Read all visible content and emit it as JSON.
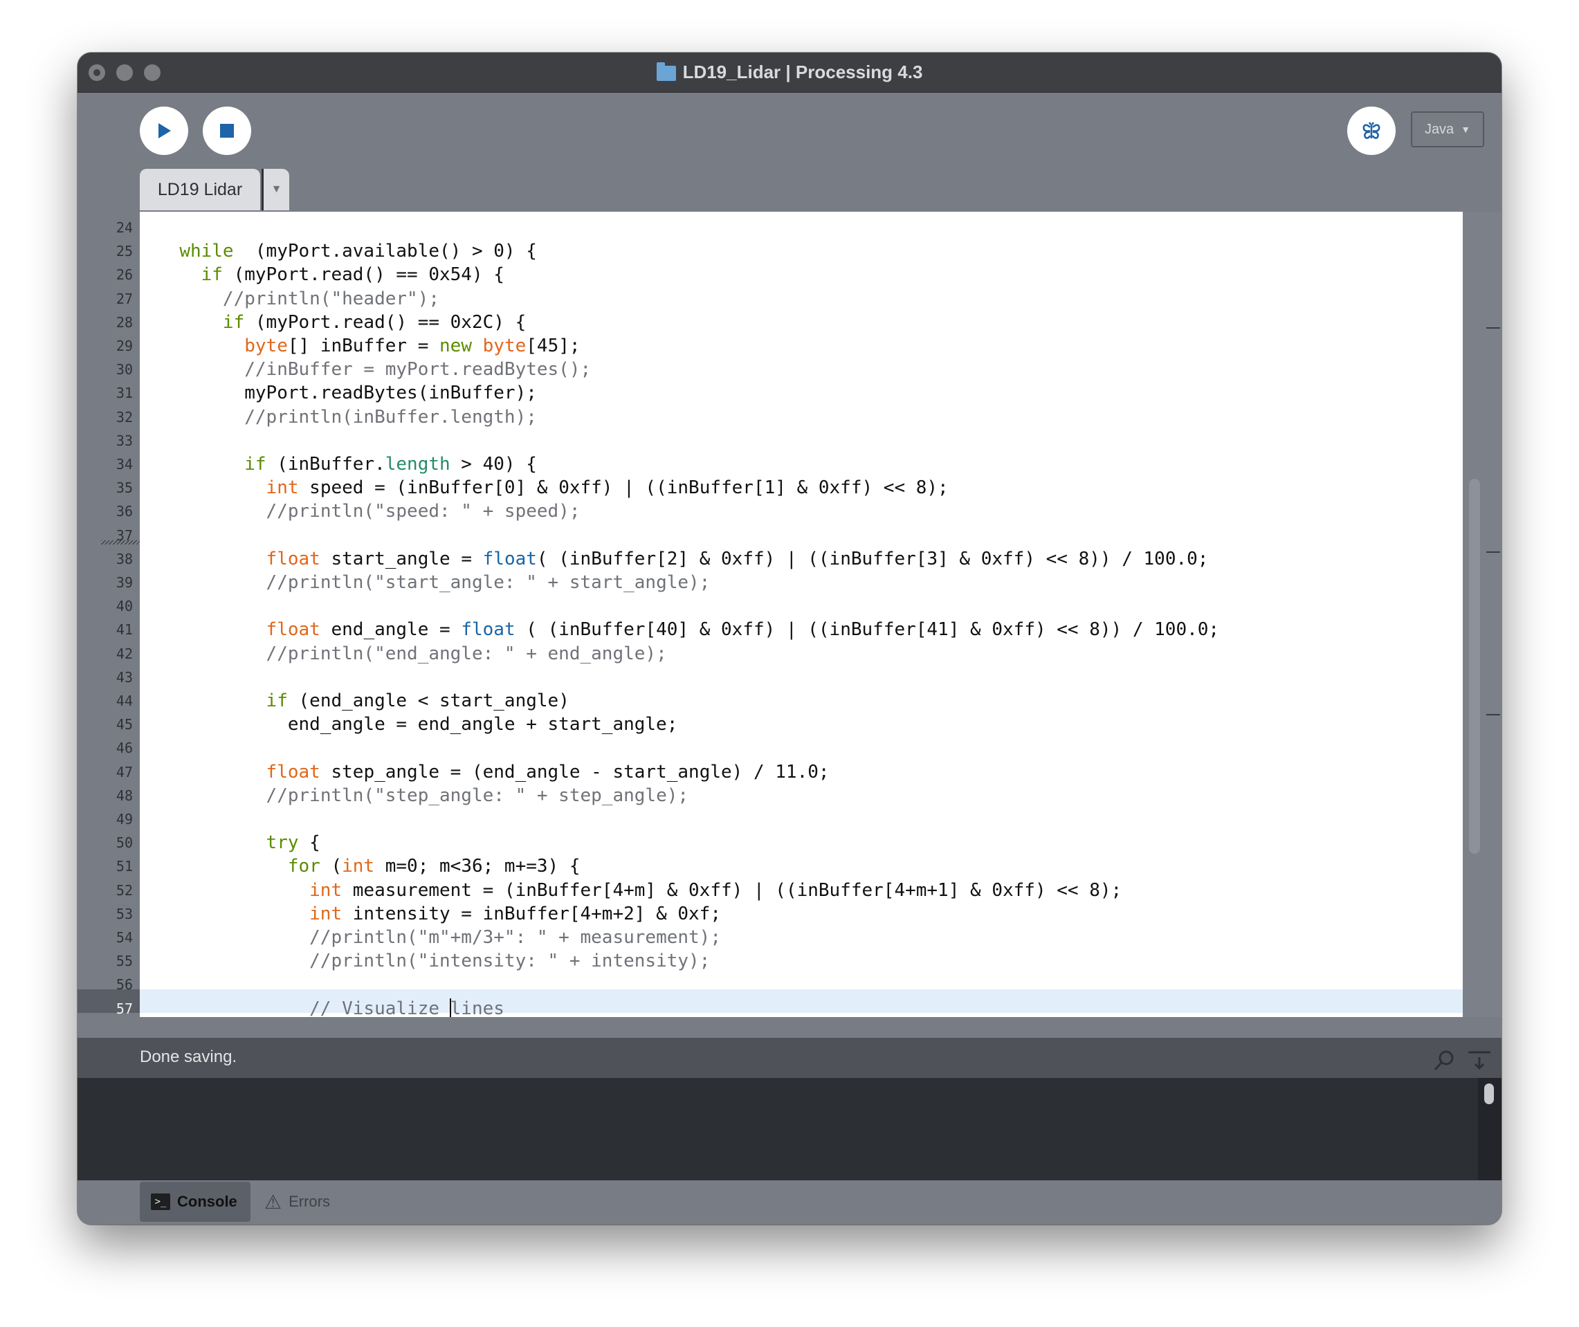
{
  "window": {
    "title": "LD19_Lidar | Processing 4.3"
  },
  "toolbar": {
    "run_icon": "play-icon",
    "stop_icon": "stop-icon",
    "debug_icon": "butterfly-icon",
    "mode_label": "Java",
    "mode_caret": "▼"
  },
  "tabs": [
    {
      "label": "LD19 Lidar"
    }
  ],
  "tab_menu_glyph": "▼",
  "editor": {
    "current_line": "57",
    "lines": [
      {
        "n": "24",
        "parts": []
      },
      {
        "n": "25",
        "parts": [
          [
            "k1",
            "while"
          ],
          [
            "",
            "  (myPort.available() > 0) {"
          ]
        ],
        "indent": "  "
      },
      {
        "n": "26",
        "parts": [
          [
            "k1",
            "if"
          ],
          [
            "",
            " (myPort.read() == 0x54) {"
          ]
        ],
        "indent": "    "
      },
      {
        "n": "27",
        "parts": [
          [
            "c",
            "//println(\"header\");"
          ]
        ],
        "indent": "      "
      },
      {
        "n": "28",
        "parts": [
          [
            "k1",
            "if"
          ],
          [
            "",
            " (myPort.read() == 0x2C) {"
          ]
        ],
        "indent": "      "
      },
      {
        "n": "29",
        "parts": [
          [
            "k2",
            "byte"
          ],
          [
            "",
            "[] inBuffer = "
          ],
          [
            "k1",
            "new"
          ],
          [
            "",
            " "
          ],
          [
            "k2",
            "byte"
          ],
          [
            "",
            "[45];"
          ]
        ],
        "indent": "        "
      },
      {
        "n": "30",
        "parts": [
          [
            "c",
            "//inBuffer = myPort.readBytes();"
          ]
        ],
        "indent": "        "
      },
      {
        "n": "31",
        "parts": [
          [
            "",
            "myPort.readBytes(inBuffer);"
          ]
        ],
        "indent": "        "
      },
      {
        "n": "32",
        "parts": [
          [
            "c",
            "//println(inBuffer.length);"
          ]
        ],
        "indent": "        "
      },
      {
        "n": "33",
        "parts": []
      },
      {
        "n": "34",
        "parts": [
          [
            "k1",
            "if"
          ],
          [
            "",
            " (inBuffer."
          ],
          [
            "f",
            "length"
          ],
          [
            "",
            " > 40) {"
          ]
        ],
        "indent": "        "
      },
      {
        "n": "35",
        "parts": [
          [
            "k2",
            "int"
          ],
          [
            "",
            " speed = (inBuffer[0] & 0xff) | ((inBuffer[1] & 0xff) << 8);"
          ]
        ],
        "indent": "          "
      },
      {
        "n": "36",
        "parts": [
          [
            "c",
            "//println(\"speed: \" + speed);"
          ]
        ],
        "indent": "          "
      },
      {
        "n": "37",
        "parts": []
      },
      {
        "n": "38",
        "parts": [
          [
            "k2",
            "float"
          ],
          [
            "",
            " start_angle = "
          ],
          [
            "k3",
            "float"
          ],
          [
            "",
            "( (inBuffer[2] & 0xff) | ((inBuffer[3] & 0xff) << 8)) / 100.0;"
          ]
        ],
        "indent": "          "
      },
      {
        "n": "39",
        "parts": [
          [
            "c",
            "//println(\"start_angle: \" + start_angle);"
          ]
        ],
        "indent": "          "
      },
      {
        "n": "40",
        "parts": []
      },
      {
        "n": "41",
        "parts": [
          [
            "k2",
            "float"
          ],
          [
            "",
            " end_angle = "
          ],
          [
            "k3",
            "float"
          ],
          [
            "",
            " ( (inBuffer[40] & 0xff) | ((inBuffer[41] & 0xff) << 8)) / 100.0;"
          ]
        ],
        "indent": "          "
      },
      {
        "n": "42",
        "parts": [
          [
            "c",
            "//println(\"end_angle: \" + end_angle);"
          ]
        ],
        "indent": "          "
      },
      {
        "n": "43",
        "parts": []
      },
      {
        "n": "44",
        "parts": [
          [
            "k1",
            "if"
          ],
          [
            "",
            " (end_angle < start_angle)"
          ]
        ],
        "indent": "          "
      },
      {
        "n": "45",
        "parts": [
          [
            "",
            "end_angle = end_angle + start_angle;"
          ]
        ],
        "indent": "            "
      },
      {
        "n": "46",
        "parts": []
      },
      {
        "n": "47",
        "parts": [
          [
            "k2",
            "float"
          ],
          [
            "",
            " step_angle = (end_angle - start_angle) / 11.0;"
          ]
        ],
        "indent": "          "
      },
      {
        "n": "48",
        "parts": [
          [
            "c",
            "//println(\"step_angle: \" + step_angle);"
          ]
        ],
        "indent": "          "
      },
      {
        "n": "49",
        "parts": []
      },
      {
        "n": "50",
        "parts": [
          [
            "k1",
            "try"
          ],
          [
            "",
            " {"
          ]
        ],
        "indent": "          "
      },
      {
        "n": "51",
        "parts": [
          [
            "k1",
            "for"
          ],
          [
            "",
            " ("
          ],
          [
            "k2",
            "int"
          ],
          [
            "",
            " m=0; m<36; m+=3) {"
          ]
        ],
        "indent": "            "
      },
      {
        "n": "52",
        "parts": [
          [
            "k2",
            "int"
          ],
          [
            "",
            " measurement = (inBuffer[4+m] & 0xff) | ((inBuffer[4+m+1] & 0xff) << 8);"
          ]
        ],
        "indent": "              "
      },
      {
        "n": "53",
        "parts": [
          [
            "k2",
            "int"
          ],
          [
            "",
            " intensity = inBuffer[4+m+2] & 0xf;"
          ]
        ],
        "indent": "              "
      },
      {
        "n": "54",
        "parts": [
          [
            "c",
            "//println(\"m\"+m/3+\": \" + measurement);"
          ]
        ],
        "indent": "              "
      },
      {
        "n": "55",
        "parts": [
          [
            "c",
            "//println(\"intensity: \" + intensity);"
          ]
        ],
        "indent": "              "
      },
      {
        "n": "56",
        "parts": []
      },
      {
        "n": "57",
        "parts": [
          [
            "c",
            "// Visualize "
          ],
          [
            "caret",
            ""
          ],
          [
            "c",
            "lines"
          ]
        ],
        "indent": "              "
      }
    ]
  },
  "status": {
    "message": "Done saving.",
    "find_icon": "magnifier-icon",
    "clear_icon": "clear-console-icon"
  },
  "bottom_tabs": [
    {
      "label": "Console",
      "icon": "terminal-icon",
      "glyph": ">_"
    },
    {
      "label": "Errors",
      "icon": "warning-icon",
      "glyph": "⚠"
    }
  ]
}
